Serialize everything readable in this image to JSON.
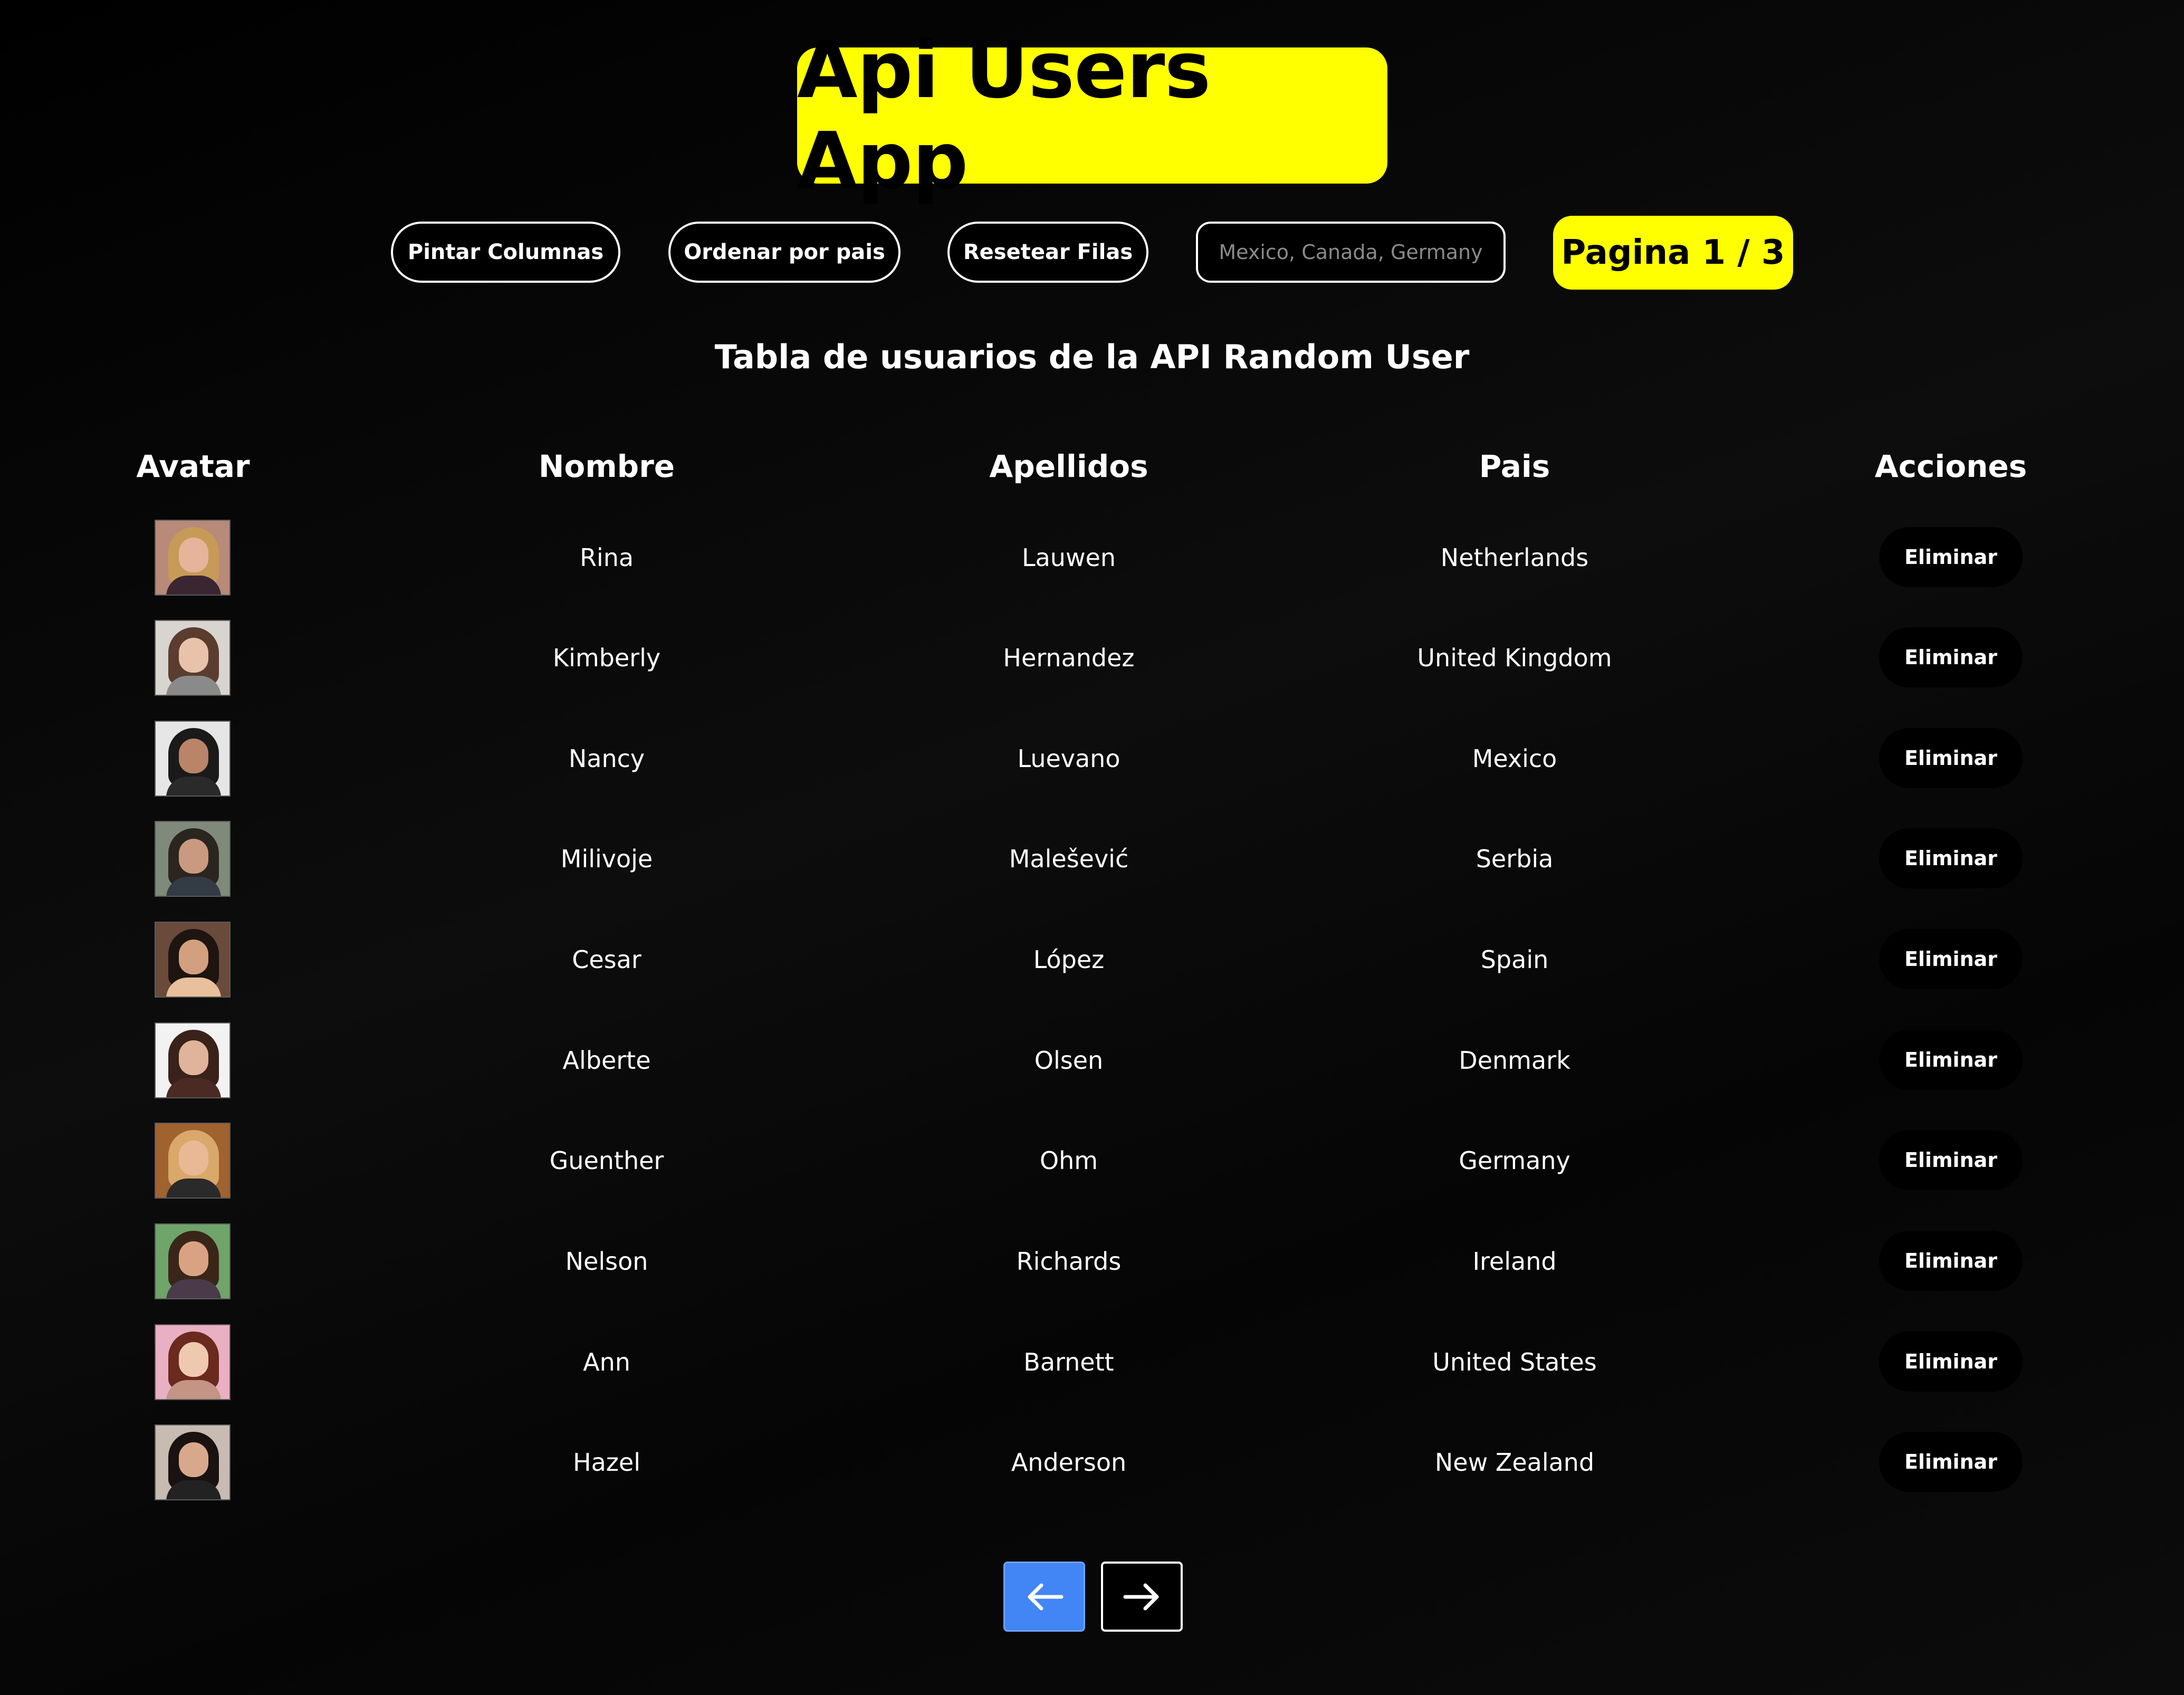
{
  "app": {
    "title": "Api Users App"
  },
  "controls": {
    "paint_columns_label": "Pintar Columnas",
    "sort_by_country_label": "Ordenar por pais",
    "reset_rows_label": "Resetear Filas",
    "country_filter_placeholder": "Mexico, Canada, Germany",
    "country_filter_value": "",
    "page_indicator": "Pagina 1 / 3"
  },
  "table": {
    "title": "Tabla de usuarios de la API Random User",
    "headers": {
      "avatar": "Avatar",
      "first_name": "Nombre",
      "last_name": "Apellidos",
      "country": "Pais",
      "actions": "Acciones"
    },
    "delete_label": "Eliminar",
    "rows": [
      {
        "first_name": "Rina",
        "last_name": "Lauwen",
        "country": "Netherlands"
      },
      {
        "first_name": "Kimberly",
        "last_name": "Hernandez",
        "country": "United Kingdom"
      },
      {
        "first_name": "Nancy",
        "last_name": "Luevano",
        "country": "Mexico"
      },
      {
        "first_name": "Milivoje",
        "last_name": "Malešević",
        "country": "Serbia"
      },
      {
        "first_name": "Cesar",
        "last_name": "López",
        "country": "Spain"
      },
      {
        "first_name": "Alberte",
        "last_name": "Olsen",
        "country": "Denmark"
      },
      {
        "first_name": "Guenther",
        "last_name": "Ohm",
        "country": "Germany"
      },
      {
        "first_name": "Nelson",
        "last_name": "Richards",
        "country": "Ireland"
      },
      {
        "first_name": "Ann",
        "last_name": "Barnett",
        "country": "United States"
      },
      {
        "first_name": "Hazel",
        "last_name": "Anderson",
        "country": "New Zealand"
      }
    ]
  },
  "pagination": {
    "prev_icon": "arrow-left-icon",
    "next_icon": "arrow-right-icon"
  },
  "colors": {
    "accent_yellow": "#ffff00",
    "prev_button_blue": "#4285f4",
    "background": "#000000"
  }
}
